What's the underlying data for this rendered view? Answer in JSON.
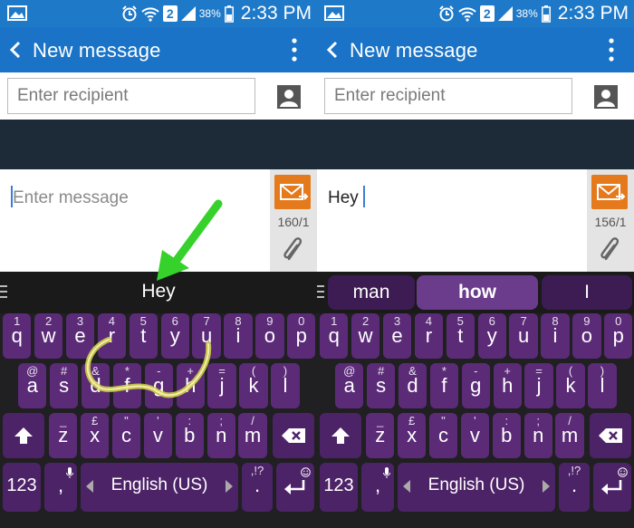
{
  "status": {
    "signal_badge": "2",
    "battery": "38%",
    "time": "2:33 PM"
  },
  "appbar": {
    "title": "New message"
  },
  "recipient": {
    "placeholder": "Enter recipient"
  },
  "left": {
    "message_placeholder": "Enter message",
    "counter": "160/1",
    "suggestion": "Hey"
  },
  "right": {
    "message_text": "Hey",
    "counter": "156/1",
    "suggestions": [
      "man",
      "how",
      "I"
    ]
  },
  "keyboard": {
    "row1": [
      {
        "k": "q",
        "s": "1"
      },
      {
        "k": "w",
        "s": "2"
      },
      {
        "k": "e",
        "s": "3"
      },
      {
        "k": "r",
        "s": "4"
      },
      {
        "k": "t",
        "s": "5"
      },
      {
        "k": "y",
        "s": "6"
      },
      {
        "k": "u",
        "s": "7"
      },
      {
        "k": "i",
        "s": "8"
      },
      {
        "k": "o",
        "s": "9"
      },
      {
        "k": "p",
        "s": "0"
      }
    ],
    "row2": [
      {
        "k": "a",
        "s": "@"
      },
      {
        "k": "s",
        "s": "#"
      },
      {
        "k": "d",
        "s": "&"
      },
      {
        "k": "f",
        "s": "*"
      },
      {
        "k": "g",
        "s": "-"
      },
      {
        "k": "h",
        "s": "+"
      },
      {
        "k": "j",
        "s": "="
      },
      {
        "k": "k",
        "s": "("
      },
      {
        "k": "l",
        "s": ")"
      }
    ],
    "row3": [
      {
        "k": "z",
        "s": "_"
      },
      {
        "k": "x",
        "s": "£"
      },
      {
        "k": "c",
        "s": "\""
      },
      {
        "k": "v",
        "s": "'"
      },
      {
        "k": "b",
        "s": ":"
      },
      {
        "k": "n",
        "s": ";"
      },
      {
        "k": "m",
        "s": "/"
      }
    ],
    "num_label": "123",
    "comma_label": ",",
    "language": "English (US)",
    "period_label": ".",
    "period_sub": ",!?"
  },
  "colors": {
    "statusbar": "#1e79c9",
    "appbar": "#1a73c6",
    "key": "#5b2b78",
    "send": "#e57a1c",
    "swipe_trail": "#d8d84a",
    "arrow": "#36d12b"
  }
}
